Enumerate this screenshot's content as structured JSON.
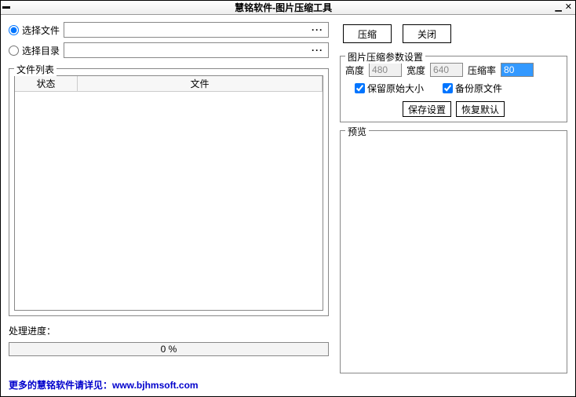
{
  "window": {
    "title": "慧铭软件-图片压缩工具"
  },
  "radios": {
    "selectFile": "选择文件",
    "selectDir": "选择目录"
  },
  "filelist": {
    "title": "文件列表",
    "colStatus": "状态",
    "colFile": "文件"
  },
  "progress": {
    "label": "处理进度：",
    "text": "0 %"
  },
  "buttons": {
    "compress": "压缩",
    "close": "关闭",
    "saveSettings": "保存设置",
    "restoreDefault": "恢复默认"
  },
  "params": {
    "title": "图片压缩参数设置",
    "heightLabel": "高度",
    "heightValue": "480",
    "widthLabel": "宽度",
    "widthValue": "640",
    "ratioLabel": "压缩率",
    "ratioValue": "80",
    "keepOriginalSize": "保留原始大小",
    "backupOriginal": "备份原文件"
  },
  "preview": {
    "title": "预览"
  },
  "footer": {
    "prefix": "更多的慧铭软件请详见：",
    "url": "www.bjhmsoft.com"
  }
}
